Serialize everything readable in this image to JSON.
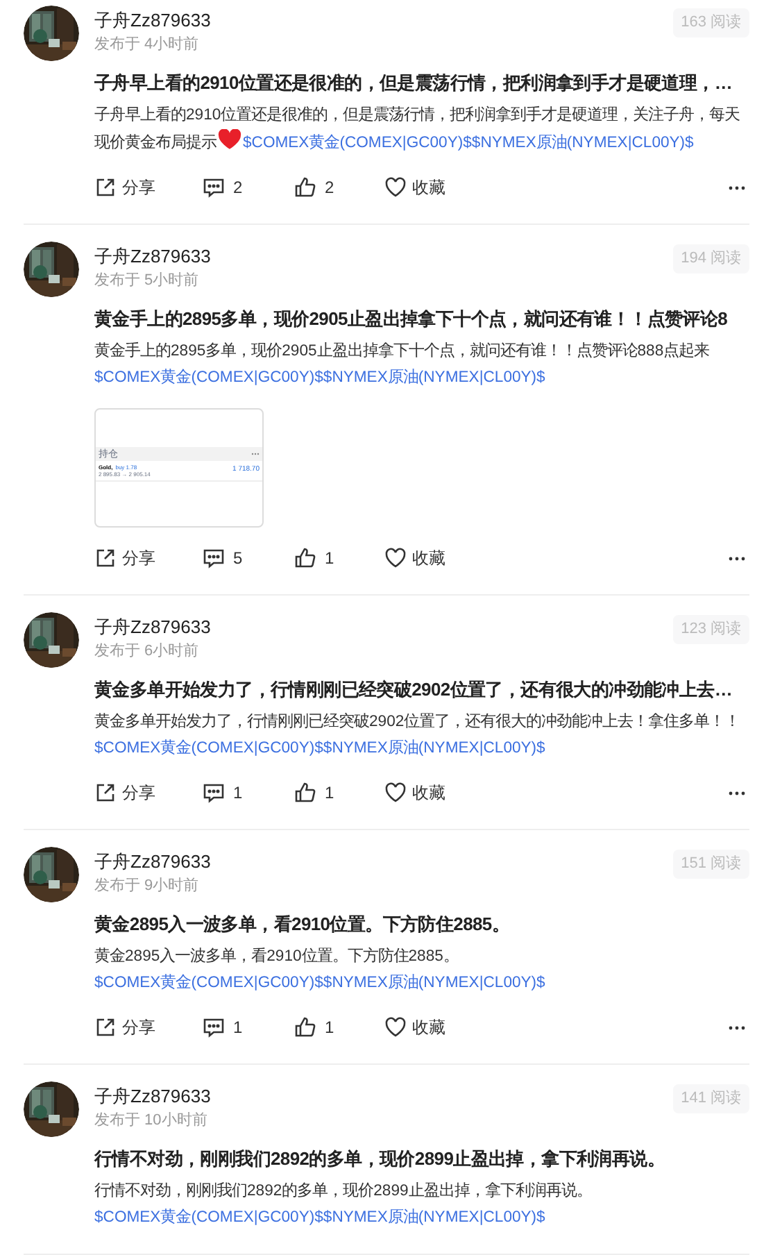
{
  "posts": [
    {
      "author": "子舟Zz879633",
      "time": "发布于 4小时前",
      "views": "163 阅读",
      "title": "子舟早上看的2910位置还是很准的，但是震荡行情，把利润拿到手才是硬道理，…",
      "body": [
        {
          "kind": "plain",
          "text": "子舟早上看的2910位置还是很准的，但是震荡行情，把利润拿到手才是硬道理，关注子舟，每天现价黄金布局提示"
        },
        {
          "kind": "heart"
        },
        {
          "kind": "link",
          "text": " $COMEX黄金(COMEX|GC00Y)$$NYMEX原油(NYMEX|CL00Y)$"
        }
      ],
      "share": "分享",
      "comments": "2",
      "likes": "2",
      "favorite": "收藏"
    },
    {
      "author": "子舟Zz879633",
      "time": "发布于 5小时前",
      "views": "194 阅读",
      "title": "黄金手上的2895多单，现价2905止盈出掉拿下十个点，就问还有谁！！点赞评论8",
      "body": [
        {
          "kind": "plain",
          "text": "黄金手上的2895多单，现价2905止盈出掉拿下十个点，就问还有谁！！点赞评论888点起来"
        },
        {
          "kind": "link",
          "text": "$COMEX黄金(COMEX|GC00Y)$$NYMEX原油(NYMEX|CL00Y)$"
        }
      ],
      "thumbnail": {
        "header": "持仓",
        "symbol": "Gold,",
        "order": "buy 1.78",
        "prices": "2 895.83 → 2 905.14",
        "profit": "1 718.70"
      },
      "share": "分享",
      "comments": "5",
      "likes": "1",
      "favorite": "收藏"
    },
    {
      "author": "子舟Zz879633",
      "time": "发布于 6小时前",
      "views": "123 阅读",
      "title": "黄金多单开始发力了，行情刚刚已经突破2902位置了，还有很大的冲劲能冲上去…",
      "body": [
        {
          "kind": "plain",
          "text": "黄金多单开始发力了，行情刚刚已经突破2902位置了，还有很大的冲劲能冲上去！拿住多单！！ "
        },
        {
          "kind": "link",
          "text": "$COMEX黄金(COMEX|GC00Y)$$NYMEX原油(NYMEX|CL00Y)$"
        }
      ],
      "share": "分享",
      "comments": "1",
      "likes": "1",
      "favorite": "收藏"
    },
    {
      "author": "子舟Zz879633",
      "time": "发布于 9小时前",
      "views": "151 阅读",
      "title": "黄金2895入一波多单，看2910位置。下方防住2885。",
      "body": [
        {
          "kind": "plain",
          "text": "黄金2895入一波多单，看2910位置。下方防住2885。"
        },
        {
          "kind": "link",
          "text": "$COMEX黄金(COMEX|GC00Y)$$NYMEX原油(NYMEX|CL00Y)$"
        }
      ],
      "share": "分享",
      "comments": "1",
      "likes": "1",
      "favorite": "收藏"
    },
    {
      "author": "子舟Zz879633",
      "time": "发布于 10小时前",
      "views": "141 阅读",
      "title": "行情不对劲，刚刚我们2892的多单，现价2899止盈出掉，拿下利润再说。",
      "body": [
        {
          "kind": "plain",
          "text": "行情不对劲，刚刚我们2892的多单，现价2899止盈出掉，拿下利润再说。"
        },
        {
          "kind": "link",
          "text": "$COMEX黄金(COMEX|GC00Y)$$NYMEX原油(NYMEX|CL00Y)$"
        }
      ]
    }
  ]
}
